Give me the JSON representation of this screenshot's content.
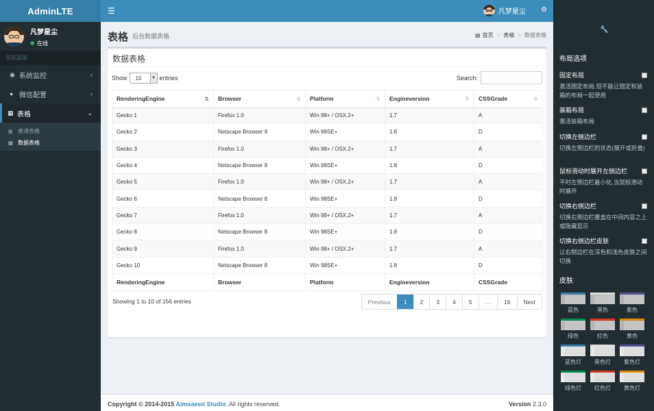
{
  "app": {
    "logo": "AdminLTE"
  },
  "user": {
    "name": "凡梦星尘",
    "status": "在线"
  },
  "nav": {
    "header": "导航菜单",
    "items": [
      {
        "label": "系统监控",
        "icon": "dashboard-icon"
      },
      {
        "label": "微信配置",
        "icon": "wechat-icon"
      },
      {
        "label": "表格",
        "icon": "table-icon"
      }
    ],
    "sub": [
      {
        "label": "普通表格",
        "icon": "table-icon"
      },
      {
        "label": "数据表格",
        "icon": "list-icon"
      }
    ]
  },
  "topbar": {
    "user": "凡梦星尘"
  },
  "page": {
    "title": "表格",
    "subtitle": "后台数据表格"
  },
  "breadcrumb": {
    "home": "首页",
    "level1": "表格",
    "current": "数据表格"
  },
  "box": {
    "title": "数据表格"
  },
  "controls": {
    "show": "Show",
    "length": "10",
    "entries": "entries",
    "search": "Search:"
  },
  "table": {
    "columns": [
      "RenderingEngine",
      "Browser",
      "Platform",
      "Engineversion",
      "CSSGrade"
    ],
    "rows": [
      [
        "Gecko 1",
        "Firefox 1.0",
        "Win 98+ / OSX.2+",
        "1.7",
        "A"
      ],
      [
        "Gecko 2",
        "Netscape Browser 8",
        "Win 98SE+",
        "1.8",
        "D"
      ],
      [
        "Gecko 3",
        "Firefox 1.0",
        "Win 98+ / OSX.2+",
        "1.7",
        "A"
      ],
      [
        "Gecko 4",
        "Netscape Browser 8",
        "Win 98SE+",
        "1.8",
        "D"
      ],
      [
        "Gecko 5",
        "Firefox 1.0",
        "Win 98+ / OSX.2+",
        "1.7",
        "A"
      ],
      [
        "Gecko 6",
        "Netscape Browser 8",
        "Win 98SE+",
        "1.8",
        "D"
      ],
      [
        "Gecko 7",
        "Firefox 1.0",
        "Win 98+ / OSX.2+",
        "1.7",
        "A"
      ],
      [
        "Gecko 8",
        "Netscape Browser 8",
        "Win 98SE+",
        "1.8",
        "D"
      ],
      [
        "Gecko 9",
        "Firefox 1.0",
        "Win 98+ / OSX.2+",
        "1.7",
        "A"
      ],
      [
        "Gecko 10",
        "Netscape Browser 8",
        "Win 98SE+",
        "1.8",
        "D"
      ]
    ]
  },
  "pagination": {
    "info": "Showing 1 to 10 of 156 entries",
    "pages": [
      "Previous",
      "1",
      "2",
      "3",
      "4",
      "5",
      "…",
      "16",
      "Next"
    ],
    "active": "1"
  },
  "footer": {
    "prefix": "Copyright © 2014-2015 ",
    "company": "Almsaeed Studio",
    "suffix": ". All rights reserved.",
    "version_label": "Version",
    "version": "2.3.0"
  },
  "control_sidebar": {
    "layout_title": "布局选项",
    "options": [
      {
        "label": "固定布局",
        "desc": "激活固定布局,但不能让固定和装箱的布局一起使用"
      },
      {
        "label": "装箱布局",
        "desc": "激活装箱布局"
      },
      {
        "label": "切换左侧边栏",
        "desc": "切换左侧边栏的状态(展开或折叠)"
      },
      {
        "label": "鼠标滑动时展开左侧边栏",
        "desc": "平时左侧边栏最小化,当鼠标滑动时展开"
      },
      {
        "label": "切换右侧边栏",
        "desc": "切换右侧边栏覆盖在中间内容之上或隐藏显示"
      },
      {
        "label": "切换右侧边栏皮肤",
        "desc": "让右侧边栏在深色和浅色皮肤之间切换"
      }
    ],
    "skins_title": "皮肤",
    "skins": [
      {
        "label": "蓝色",
        "color": "#367fa9",
        "light": false
      },
      {
        "label": "黑色",
        "color": "#dddddd",
        "light": false
      },
      {
        "label": "紫色",
        "color": "#555299",
        "light": false
      },
      {
        "label": "绿色",
        "color": "#008d4c",
        "light": false
      },
      {
        "label": "红色",
        "color": "#d33724",
        "light": false
      },
      {
        "label": "黄色",
        "color": "#db8b0b",
        "light": false
      },
      {
        "label": "蓝色灯",
        "color": "#367fa9",
        "light": true
      },
      {
        "label": "黑色灯",
        "color": "#dddddd",
        "light": true
      },
      {
        "label": "紫色灯",
        "color": "#555299",
        "light": true
      },
      {
        "label": "绿色灯",
        "color": "#008d4c",
        "light": true
      },
      {
        "label": "红色灯",
        "color": "#d33724",
        "light": true
      },
      {
        "label": "黄色灯",
        "color": "#db8b0b",
        "light": true
      }
    ]
  }
}
